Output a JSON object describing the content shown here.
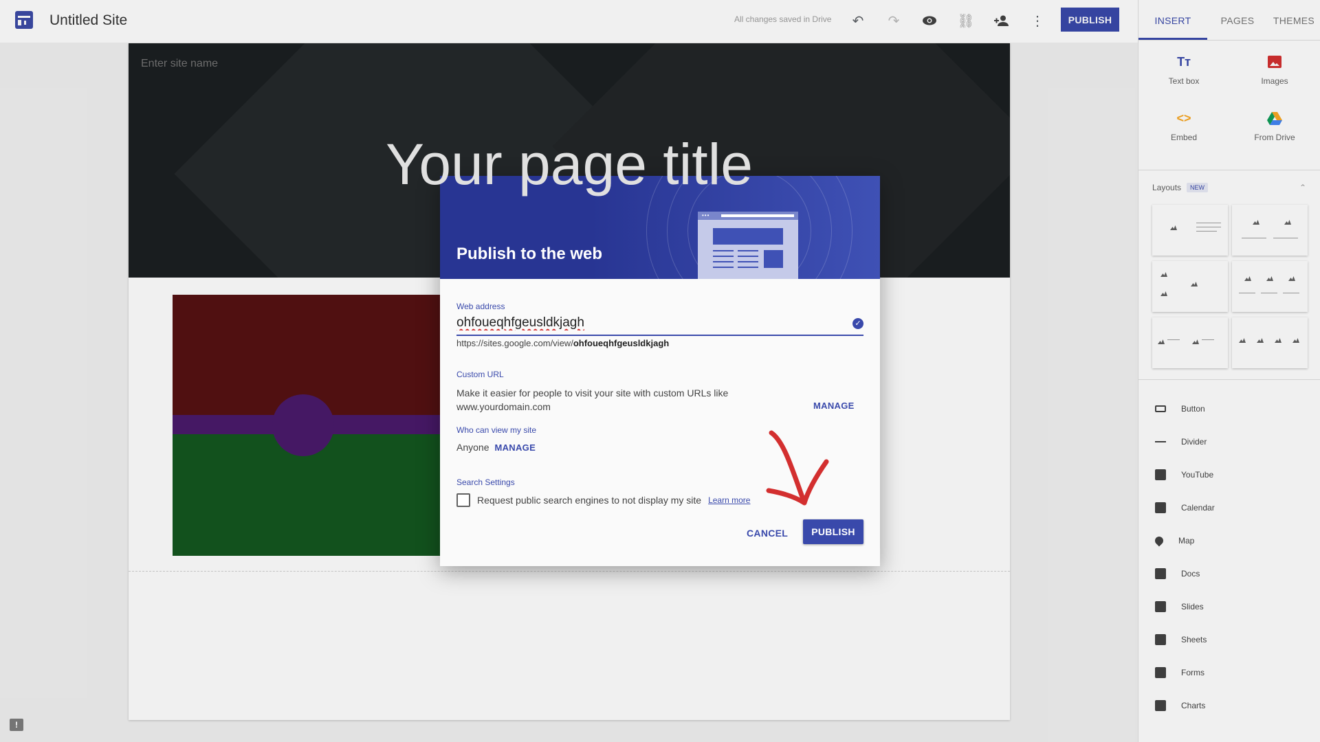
{
  "topbar": {
    "site_title": "Untitled Site",
    "saved_status": "All changes saved in Drive",
    "publish_label": "PUBLISH"
  },
  "panel": {
    "tabs": [
      "INSERT",
      "PAGES",
      "THEMES"
    ],
    "insert_items": [
      {
        "label": "Text box",
        "icon": "text-box-icon",
        "color": "#3949ab"
      },
      {
        "label": "Images",
        "icon": "image-icon",
        "color": "#d32f2f"
      },
      {
        "label": "Embed",
        "icon": "embed-icon",
        "color": "#f9a825"
      },
      {
        "label": "From Drive",
        "icon": "drive-icon",
        "color": "#0f9d58"
      }
    ],
    "layouts_label": "Layouts",
    "new_badge": "NEW",
    "elements": [
      "Button",
      "Divider",
      "YouTube",
      "Calendar",
      "Map",
      "Docs",
      "Slides",
      "Sheets",
      "Forms",
      "Charts"
    ]
  },
  "canvas": {
    "site_name_placeholder": "Enter site name",
    "page_title": "Your page title"
  },
  "dialog": {
    "title": "Publish to the web",
    "web_address_label": "Web address",
    "web_address_value": "ohfoueqhfgeusldkjagh",
    "url_prefix": "https://sites.google.com/view/",
    "url_slug": "ohfoueqhfgeusldkjagh",
    "custom_url_label": "Custom URL",
    "custom_url_desc": "Make it easier for people to visit your site with custom URLs like www.yourdomain.com",
    "custom_url_manage": "MANAGE",
    "who_can_view_label": "Who can view my site",
    "who_can_view_value": "Anyone",
    "who_can_view_manage": "MANAGE",
    "search_settings_label": "Search Settings",
    "search_checkbox_label": "Request public search engines to not display my site",
    "learn_more": "Learn more",
    "cancel_label": "CANCEL",
    "publish_label": "PUBLISH"
  },
  "colors": {
    "accent": "#3949ab",
    "annotation": "#d32f2f"
  }
}
